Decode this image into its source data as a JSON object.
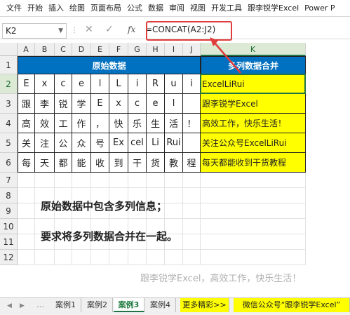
{
  "ribbon": {
    "tabs": [
      "文件",
      "开始",
      "插入",
      "绘图",
      "页面布局",
      "公式",
      "数据",
      "审阅",
      "视图",
      "开发工具",
      "跟李锐学Excel",
      "Power P"
    ]
  },
  "formula_bar": {
    "name_box": "K2",
    "formula": "=CONCAT(A2:J2)",
    "cancel_symbol": "✕",
    "enter_symbol": "✓",
    "fx_symbol": "fx"
  },
  "columns": [
    "A",
    "B",
    "C",
    "D",
    "E",
    "F",
    "G",
    "H",
    "I",
    "J",
    "K"
  ],
  "rows": [
    "1",
    "2",
    "3",
    "4",
    "5",
    "6",
    "7",
    "8",
    "9",
    "10",
    "11",
    "12"
  ],
  "table": {
    "header_left": "原始数据",
    "header_right": "多列数据合并",
    "data": [
      [
        "E",
        "x",
        "c",
        "e",
        "l",
        "L",
        "i",
        "R",
        "u",
        "i"
      ],
      [
        "跟",
        "李",
        "锐",
        "学",
        "E",
        "x",
        "c",
        "e",
        "l",
        ""
      ],
      [
        "高",
        "效",
        "工",
        "作",
        "，",
        "快",
        "乐",
        "生",
        "活",
        "！"
      ],
      [
        "关",
        "注",
        "公",
        "众",
        "号",
        "Ex",
        "cel",
        "Li",
        "Rui",
        ""
      ],
      [
        "每",
        "天",
        "都",
        "能",
        "收",
        "到",
        "干",
        "货",
        "教",
        "程"
      ]
    ],
    "merged": [
      "ExcelLiRui",
      "跟李锐学Excel",
      "高效工作，快乐生活！",
      "关注公众号ExcelLiRui",
      "每天都能收到干货教程"
    ]
  },
  "notes": {
    "line1": "原始数据中包含多列信息；",
    "line2": "要求将多列数据合并在一起。",
    "watermark": "跟李锐学Excel，高效工作，快乐生活！"
  },
  "sheet_tabs": [
    "案例1",
    "案例2",
    "案例3",
    "案例4",
    "更多精彩>>",
    "微信公众号“跟李锐学Excel”"
  ],
  "active_sheet": "案例3",
  "colors": {
    "header_blue": "#0070c0",
    "result_yellow": "#ffff00",
    "annotation_red": "#e03c3c",
    "excel_green": "#217346"
  }
}
